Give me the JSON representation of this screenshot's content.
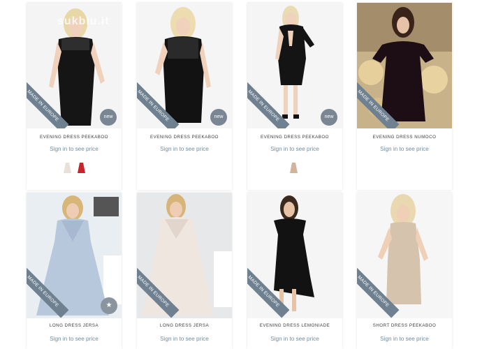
{
  "products": [
    {
      "title": "EVENING DRESS PEEKABOO",
      "price_text": "Sign in to see price",
      "ribbon": "MADE IN EUROPE",
      "badge": "new"
    },
    {
      "title": "EVENING DRESS PEEKABOO",
      "price_text": "Sign in to see price",
      "ribbon": "MADE IN EUROPE",
      "badge": "new"
    },
    {
      "title": "EVENING DRESS PEEKABOO",
      "price_text": "Sign in to see price",
      "ribbon": "MADE IN EUROPE",
      "badge": "new"
    },
    {
      "title": "EVENING DRESS NUMOCO",
      "price_text": "Sign in to see price",
      "ribbon": "MADE IN EUROPE"
    },
    {
      "title": "LONG DRESS JERSA",
      "price_text": "Sign in to see price",
      "ribbon": "MADE IN EUROPE",
      "badge": "★"
    },
    {
      "title": "LONG DRESS JERSA",
      "price_text": "Sign in to see price",
      "ribbon": "MADE IN EUROPE"
    },
    {
      "title": "EVENING DRESS LEMONIADE",
      "price_text": "Sign in to see price",
      "ribbon": "MADE IN EUROPE"
    },
    {
      "title": "SHORT DRESS PEEKABOO",
      "price_text": "Sign in to see price",
      "ribbon": "MADE IN EUROPE"
    }
  ],
  "watermark": "sukbiu.it",
  "colors": {
    "ribbon": "#6f8190",
    "badge": "#7a8694",
    "price_link": "#6f8ea6"
  }
}
